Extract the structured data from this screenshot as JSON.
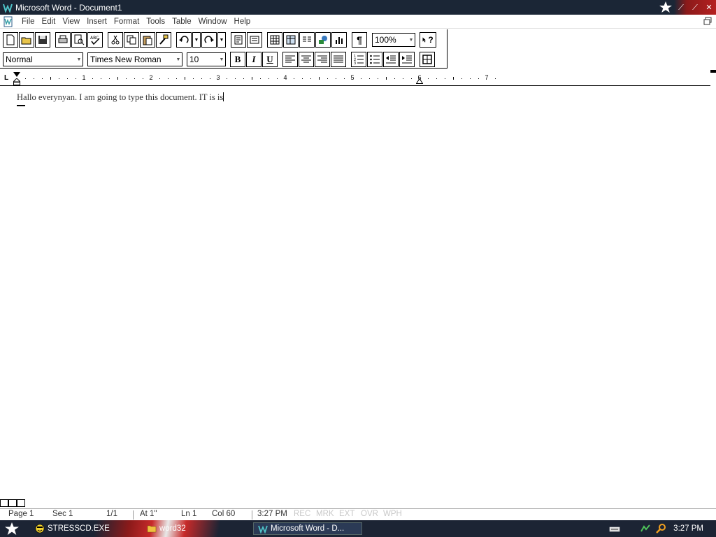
{
  "window": {
    "title": "Microsoft Word - Document1"
  },
  "menu": [
    "File",
    "Edit",
    "View",
    "Insert",
    "Format",
    "Tools",
    "Table",
    "Window",
    "Help"
  ],
  "formatting": {
    "style": "Normal",
    "font": "Times New Roman",
    "size": "10",
    "zoom": "100%",
    "bold_label": "B",
    "italic_label": "I",
    "underline_label": "U",
    "show_marks_label": "¶",
    "help_label": "?"
  },
  "ruler": {
    "ticks": [
      "1",
      "2",
      "3",
      "4",
      "5",
      "6",
      "7"
    ]
  },
  "document": {
    "text": "Hallo everynyan. I am going to type this document. IT is is"
  },
  "status": {
    "page": "Page 1",
    "section": "Sec 1",
    "pages": "1/1",
    "at": "At 1\"",
    "line": "Ln 1",
    "col": "Col 60",
    "time": "3:27 PM",
    "indicators": [
      "REC",
      "MRK",
      "EXT",
      "OVR",
      "WPH"
    ]
  },
  "taskbar": {
    "tasks": [
      "STRESSCD.EXE",
      "word32",
      "Microsoft Word - D..."
    ],
    "clock": "3:27 PM"
  },
  "colors": {
    "titlebar": "#1b2636",
    "taskbar": "#1c2434",
    "accent_red": "#b52020"
  }
}
